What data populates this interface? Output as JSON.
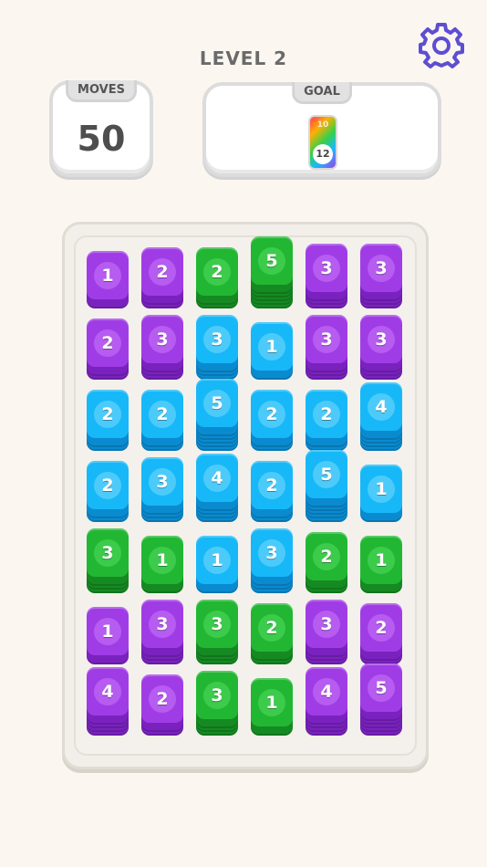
{
  "header": {
    "level_label": "LEVEL 2"
  },
  "settings": {
    "icon": "gear-icon"
  },
  "moves": {
    "label": "MOVES",
    "value": "50"
  },
  "goal": {
    "label": "GOAL",
    "tile_small": "10",
    "tile_value": "12"
  },
  "colors": {
    "purple": {
      "face": "#a03ce6",
      "side": "#7a22bf",
      "circle": "#b65cf0"
    },
    "green": {
      "face": "#22b733",
      "side": "#158a22",
      "circle": "#3ccb4b"
    },
    "blue": {
      "face": "#17b8f8",
      "side": "#0a8bd0",
      "circle": "#4ccbfb"
    }
  },
  "board": {
    "columns": 6,
    "rows": [
      [
        {
          "color": "purple",
          "value": "1",
          "height": 1
        },
        {
          "color": "purple",
          "value": "2",
          "height": 2
        },
        {
          "color": "green",
          "value": "2",
          "height": 2
        },
        {
          "color": "green",
          "value": "5",
          "height": 5
        },
        {
          "color": "purple",
          "value": "3",
          "height": 3
        },
        {
          "color": "purple",
          "value": "3",
          "height": 3
        }
      ],
      [
        {
          "color": "purple",
          "value": "2",
          "height": 2
        },
        {
          "color": "purple",
          "value": "3",
          "height": 3
        },
        {
          "color": "blue",
          "value": "3",
          "height": 3
        },
        {
          "color": "blue",
          "value": "1",
          "height": 1
        },
        {
          "color": "purple",
          "value": "3",
          "height": 3
        },
        {
          "color": "purple",
          "value": "3",
          "height": 3
        }
      ],
      [
        {
          "color": "blue",
          "value": "2",
          "height": 2
        },
        {
          "color": "blue",
          "value": "2",
          "height": 2
        },
        {
          "color": "blue",
          "value": "5",
          "height": 5
        },
        {
          "color": "blue",
          "value": "2",
          "height": 2
        },
        {
          "color": "blue",
          "value": "2",
          "height": 2
        },
        {
          "color": "blue",
          "value": "4",
          "height": 4
        }
      ],
      [
        {
          "color": "blue",
          "value": "2",
          "height": 2
        },
        {
          "color": "blue",
          "value": "3",
          "height": 3
        },
        {
          "color": "blue",
          "value": "4",
          "height": 4
        },
        {
          "color": "blue",
          "value": "2",
          "height": 2
        },
        {
          "color": "blue",
          "value": "5",
          "height": 5
        },
        {
          "color": "blue",
          "value": "1",
          "height": 1
        }
      ],
      [
        {
          "color": "green",
          "value": "3",
          "height": 3
        },
        {
          "color": "green",
          "value": "1",
          "height": 1
        },
        {
          "color": "blue",
          "value": "1",
          "height": 1
        },
        {
          "color": "blue",
          "value": "3",
          "height": 3
        },
        {
          "color": "green",
          "value": "2",
          "height": 2
        },
        {
          "color": "green",
          "value": "1",
          "height": 1
        }
      ],
      [
        {
          "color": "purple",
          "value": "1",
          "height": 1
        },
        {
          "color": "purple",
          "value": "3",
          "height": 3
        },
        {
          "color": "green",
          "value": "3",
          "height": 3
        },
        {
          "color": "green",
          "value": "2",
          "height": 2
        },
        {
          "color": "purple",
          "value": "3",
          "height": 3
        },
        {
          "color": "purple",
          "value": "2",
          "height": 2
        }
      ],
      [
        {
          "color": "purple",
          "value": "4",
          "height": 4
        },
        {
          "color": "purple",
          "value": "2",
          "height": 2
        },
        {
          "color": "green",
          "value": "3",
          "height": 3
        },
        {
          "color": "green",
          "value": "1",
          "height": 1
        },
        {
          "color": "purple",
          "value": "4",
          "height": 4
        },
        {
          "color": "purple",
          "value": "5",
          "height": 5
        }
      ]
    ]
  }
}
